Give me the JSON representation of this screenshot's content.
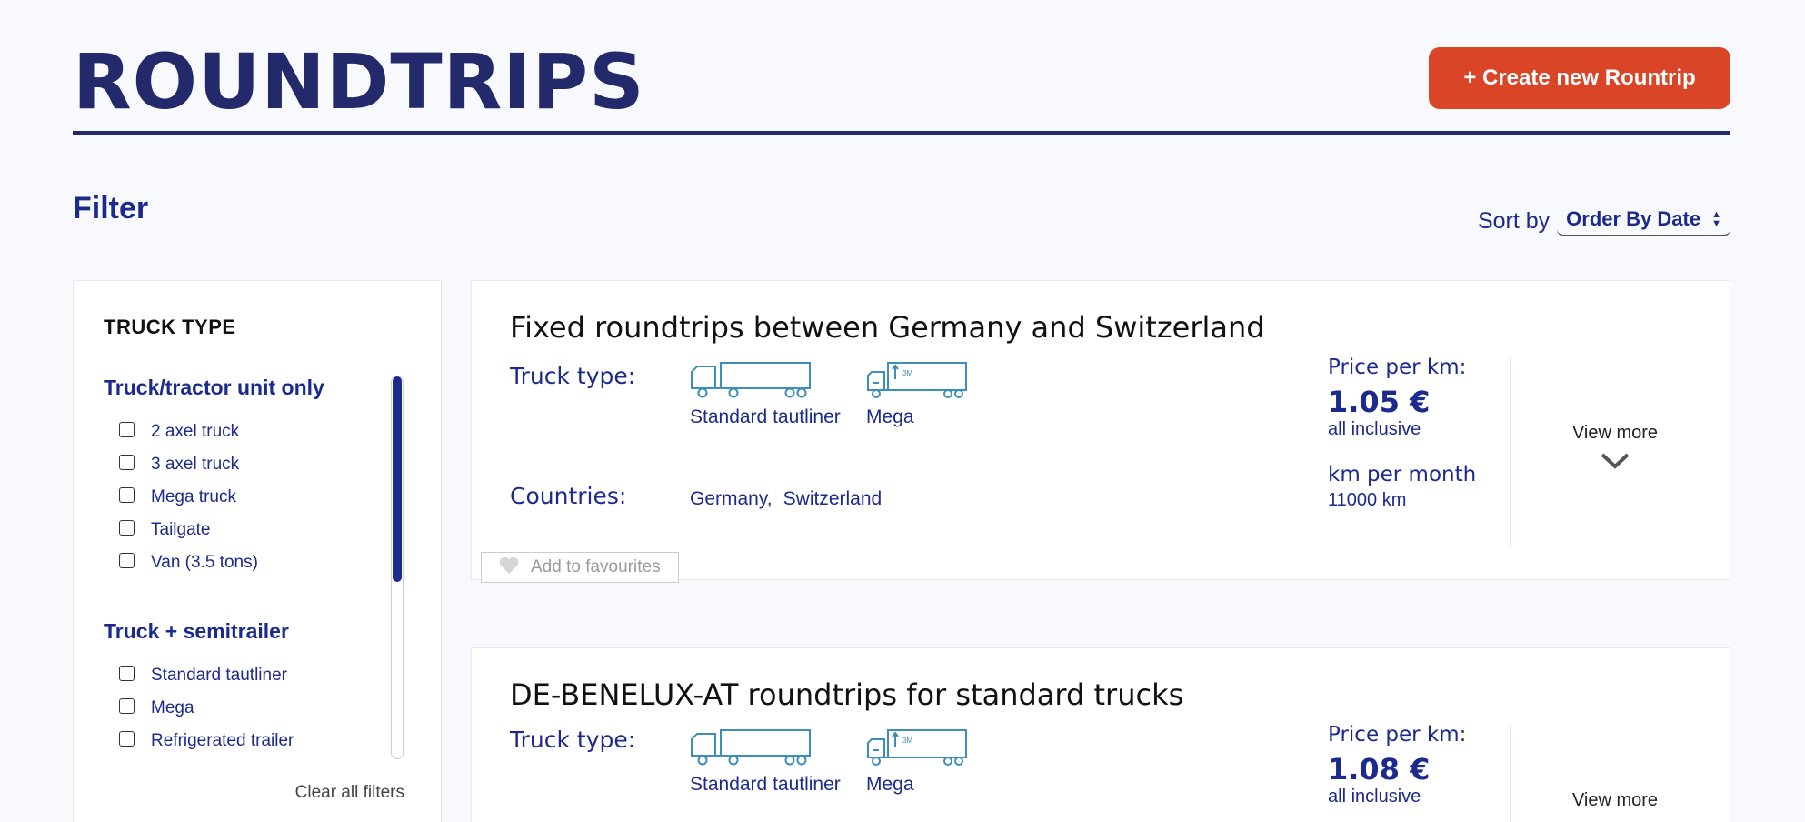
{
  "header": {
    "title": "ROUNDTRIPS",
    "create_button": "+ Create new Rountrip"
  },
  "filter": {
    "heading": "Filter",
    "section_title": "TRUCK TYPE",
    "groups": [
      {
        "title": "Truck/tractor unit only",
        "items": [
          "2 axel truck",
          "3 axel truck",
          "Mega truck",
          "Tailgate",
          "Van (3.5 tons)"
        ]
      },
      {
        "title": "Truck + semitrailer",
        "items": [
          "Standard tautliner",
          "Mega",
          "Refrigerated trailer"
        ]
      }
    ],
    "clear_label": "Clear all filters"
  },
  "sort": {
    "label": "Sort by",
    "value": "Order By Date"
  },
  "cards": [
    {
      "title": "Fixed roundtrips between Germany and Switzerland",
      "truck_type_label": "Truck type:",
      "trucks": [
        "Standard tautliner",
        "Mega"
      ],
      "countries_label": "Countries:",
      "countries": [
        "Germany,",
        "Switzerland"
      ],
      "price_label": "Price per km:",
      "price": "1.05 €",
      "price_note": "all inclusive",
      "km_label": "km per month",
      "km_value": "11000 km",
      "view_more": "View more",
      "favourites": "Add to favourites"
    },
    {
      "title": "DE-BENELUX-AT roundtrips for standard trucks",
      "truck_type_label": "Truck type:",
      "trucks": [
        "Standard tautliner",
        "Mega"
      ],
      "price_label": "Price per km:",
      "price": "1.08 €",
      "price_note": "all inclusive",
      "view_more": "View more"
    }
  ],
  "icons": {
    "tautliner": "tautliner-truck-icon",
    "mega": "mega-truck-icon",
    "chevron": "chevron-down-icon",
    "heart": "heart-icon"
  },
  "colors": {
    "navy": "#232a6b",
    "brand_blue": "#1b2a8c",
    "accent_orange": "#d94526",
    "icon_teal": "#3b8fb8"
  }
}
